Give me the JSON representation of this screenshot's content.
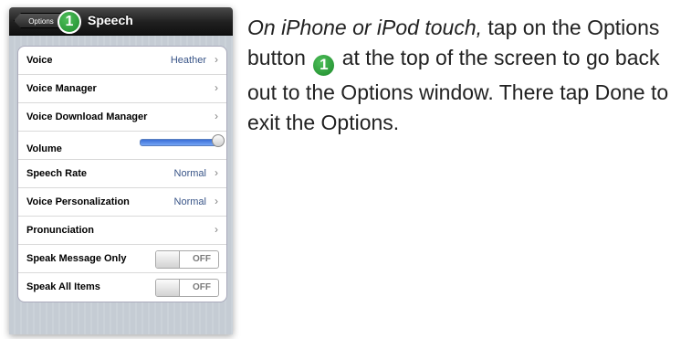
{
  "navbar": {
    "back_label": "Options",
    "callout_number": "1",
    "title": "Speech"
  },
  "settings": {
    "voice": {
      "label": "Voice",
      "value": "Heather"
    },
    "voice_manager": {
      "label": "Voice Manager"
    },
    "voice_download_manager": {
      "label": "Voice Download Manager"
    },
    "volume": {
      "label": "Volume",
      "level": 0.95
    },
    "speech_rate": {
      "label": "Speech Rate",
      "value": "Normal"
    },
    "voice_personalization": {
      "label": "Voice Personalization",
      "value": "Normal"
    },
    "pronunciation": {
      "label": "Pronunciation"
    },
    "speak_message_only": {
      "label": "Speak Message Only",
      "state": "OFF"
    },
    "speak_all_items": {
      "label": "Speak All Items",
      "state": "OFF"
    }
  },
  "instructions": {
    "lead": "On iPhone or iPod touch,",
    "part1": " tap on the Options button ",
    "callout_number": "1",
    "part2": " at the top of the screen to go back out to the Options window. There tap Done to exit the Options."
  },
  "colors": {
    "callout_green": "#2a9a37",
    "value_blue": "#385487",
    "navbar_black": "#1f1f1f",
    "slider_blue": "#3a6fd8"
  }
}
